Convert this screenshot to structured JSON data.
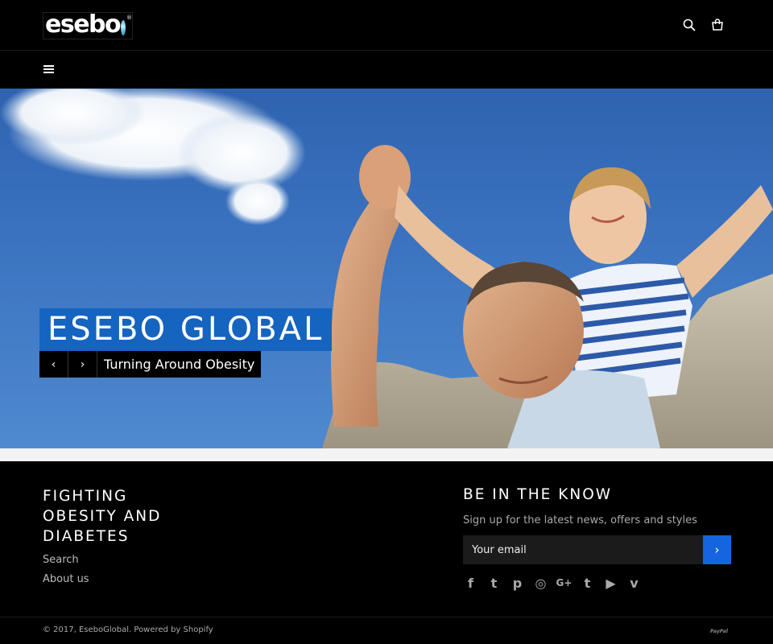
{
  "brand": {
    "logo_text": "esebo",
    "registered_mark": "®"
  },
  "header": {
    "search_icon": "search-icon",
    "cart_icon": "cart-icon",
    "menu_icon": "hamburger-menu-icon"
  },
  "hero": {
    "title": "ESEBO GLOBAL",
    "caption": "Turning Around Obesity",
    "prev_glyph": "‹",
    "next_glyph": "›"
  },
  "footer": {
    "title": "FIGHTING OBESITY AND DIABETES",
    "links": [
      "Search",
      "About us"
    ],
    "newsletter": {
      "title": "BE IN THE KNOW",
      "subtitle": "Sign up for the latest news, offers and styles",
      "placeholder": "Your email",
      "submit_glyph": "›"
    },
    "socials": [
      {
        "name": "facebook",
        "glyph": "f"
      },
      {
        "name": "twitter",
        "glyph": "t"
      },
      {
        "name": "pinterest",
        "glyph": "p"
      },
      {
        "name": "instagram",
        "glyph": "◎"
      },
      {
        "name": "google-plus",
        "glyph": "G+"
      },
      {
        "name": "tumblr",
        "glyph": "t"
      },
      {
        "name": "youtube",
        "glyph": "▶"
      },
      {
        "name": "vimeo",
        "glyph": "v"
      }
    ],
    "copyright": "© 2017, EseboGlobal. Powered by Shopify",
    "payment": "PayPal"
  },
  "colors": {
    "accent": "#1564c0",
    "button": "#1564e0",
    "background": "#000000"
  }
}
